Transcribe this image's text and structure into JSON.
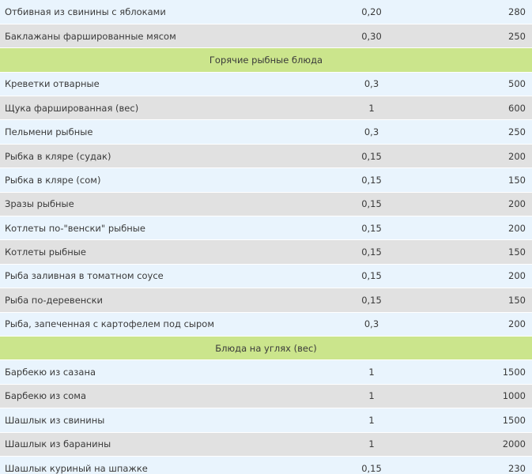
{
  "rows": [
    {
      "kind": "item",
      "name": "Отбивная из свинины с яблоками",
      "weight": "0,20",
      "price": "280"
    },
    {
      "kind": "item",
      "name": "Баклажаны фаршированные мясом",
      "weight": "0,30",
      "price": "250"
    },
    {
      "kind": "section",
      "title": "Горячие рыбные блюда"
    },
    {
      "kind": "item",
      "name": "Креветки отварные",
      "weight": "0,3",
      "price": "500"
    },
    {
      "kind": "item",
      "name": "Щука фаршированная (вес)",
      "weight": "1",
      "price": "600"
    },
    {
      "kind": "item",
      "name": "Пельмени рыбные",
      "weight": "0,3",
      "price": "250"
    },
    {
      "kind": "item",
      "name": "Рыбка в кляре (судак)",
      "weight": "0,15",
      "price": "200"
    },
    {
      "kind": "item",
      "name": "Рыбка в кляре (сом)",
      "weight": "0,15",
      "price": "150"
    },
    {
      "kind": "item",
      "name": "Зразы рыбные",
      "weight": "0,15",
      "price": "200"
    },
    {
      "kind": "item",
      "name": "Котлеты по-\"венски\" рыбные",
      "weight": "0,15",
      "price": "200"
    },
    {
      "kind": "item",
      "name": "Котлеты рыбные",
      "weight": "0,15",
      "price": "150"
    },
    {
      "kind": "item",
      "name": "Рыба заливная в томатном соусе",
      "weight": "0,15",
      "price": "200"
    },
    {
      "kind": "item",
      "name": "Рыба по-деревенски",
      "weight": "0,15",
      "price": "150"
    },
    {
      "kind": "item",
      "name": "Рыба, запеченная с картофелем под сыром",
      "weight": "0,3",
      "price": "200"
    },
    {
      "kind": "section",
      "title": "Блюда на углях (вес)"
    },
    {
      "kind": "item",
      "name": "Барбекю из сазана",
      "weight": "1",
      "price": "1500"
    },
    {
      "kind": "item",
      "name": "Барбекю из сома",
      "weight": "1",
      "price": "1000"
    },
    {
      "kind": "item",
      "name": "Шашлык из свинины",
      "weight": "1",
      "price": "1500"
    },
    {
      "kind": "item",
      "name": "Шашлык из баранины",
      "weight": "1",
      "price": "2000"
    },
    {
      "kind": "item",
      "name": "Шашлык куриный на шпажке",
      "weight": "0,15",
      "price": "230"
    }
  ]
}
